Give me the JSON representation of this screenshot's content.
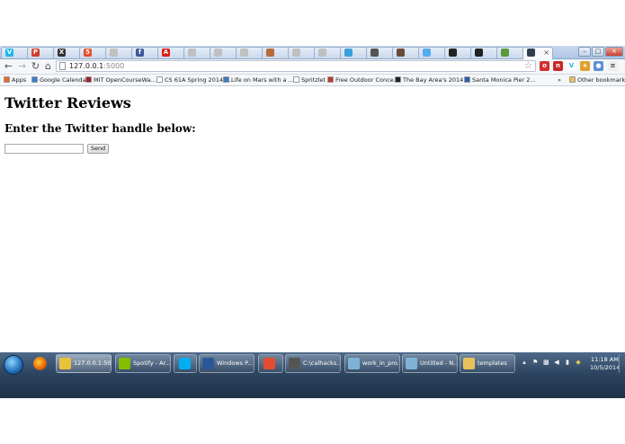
{
  "browser": {
    "tabs": [
      {
        "icon": "vimeo-icon",
        "color": "#1ab7ea",
        "glyph": "V"
      },
      {
        "icon": "pdf-icon",
        "color": "#d43b2f",
        "glyph": "P"
      },
      {
        "icon": "x-icon",
        "color": "#333333",
        "glyph": "X"
      },
      {
        "icon": "html5-icon",
        "color": "#e44d26",
        "glyph": "5"
      },
      {
        "icon": "page-icon",
        "color": "#c0c0c0",
        "glyph": ""
      },
      {
        "icon": "facebook-icon",
        "color": "#3b5998",
        "glyph": "f"
      },
      {
        "icon": "angular-icon",
        "color": "#dd1b16",
        "glyph": "A"
      },
      {
        "icon": "page-icon",
        "color": "#c0c0c0",
        "glyph": ""
      },
      {
        "icon": "page-icon",
        "color": "#c0c0c0",
        "glyph": ""
      },
      {
        "icon": "page-icon",
        "color": "#c0c0c0",
        "glyph": ""
      },
      {
        "icon": "image-icon",
        "color": "#b86b3a",
        "glyph": ""
      },
      {
        "icon": "page-icon",
        "color": "#c0c0c0",
        "glyph": ""
      },
      {
        "icon": "page-icon",
        "color": "#c0c0c0",
        "glyph": ""
      },
      {
        "icon": "tool-icon",
        "color": "#3aa0d8",
        "glyph": ""
      },
      {
        "icon": "box-icon",
        "color": "#555555",
        "glyph": ""
      },
      {
        "icon": "photo-icon",
        "color": "#6b4a3a",
        "glyph": ""
      },
      {
        "icon": "twitter-icon",
        "color": "#55acee",
        "glyph": ""
      },
      {
        "icon": "github-icon",
        "color": "#222222",
        "glyph": ""
      },
      {
        "icon": "github-icon",
        "color": "#222222",
        "glyph": ""
      },
      {
        "icon": "puzzle-icon",
        "color": "#5a9a3a",
        "glyph": ""
      },
      {
        "icon": "terminal-icon",
        "color": "#2d3e50",
        "glyph": "",
        "active": true
      }
    ],
    "address": {
      "host": "127.0.0.1",
      "port": ":5000"
    },
    "bookmarks": [
      {
        "label": "Apps",
        "color": "#e66b2a"
      },
      {
        "label": "Google Calendar",
        "color": "#3a7bd5"
      },
      {
        "label": "MIT OpenCourseWa...",
        "color": "#a31f34"
      },
      {
        "label": "CS 61A Spring 2014: ...",
        "color": "#ffffff"
      },
      {
        "label": "Life on Mars with a ...",
        "color": "#3b7bbf"
      },
      {
        "label": "Spritzlet",
        "color": "#ffffff"
      },
      {
        "label": "Free Outdoor Conce...",
        "color": "#c0392b"
      },
      {
        "label": "The Bay Area's 2014 ...",
        "color": "#222222"
      },
      {
        "label": "Santa Monica Pier 2...",
        "color": "#2a5db0"
      },
      {
        "label": "Other bookmarks",
        "color": "#e8c15a"
      }
    ],
    "bookmarks_overflow": "»"
  },
  "page": {
    "title": "Twitter Reviews",
    "subtitle": "Enter the Twitter handle below:",
    "input_value": "",
    "send_label": "Send"
  },
  "taskbar": {
    "items": [
      {
        "label": "127.0.0.1:50...",
        "icon": "chrome-icon",
        "color": "#e8c23a",
        "active": true
      },
      {
        "label": "Spotify - Ar...",
        "icon": "spotify-icon",
        "color": "#84bd00"
      },
      {
        "label": "",
        "icon": "skype-icon",
        "color": "#00aff0"
      },
      {
        "label": "Windows P...",
        "icon": "powershell-icon",
        "color": "#2b5797"
      },
      {
        "label": "",
        "icon": "git-icon",
        "color": "#e44c30"
      },
      {
        "label": "C:\\calhacks...",
        "icon": "sublime-icon",
        "color": "#555555"
      },
      {
        "label": "work_in_pro...",
        "icon": "notepad-icon",
        "color": "#7fb3d5"
      },
      {
        "label": "Untitled - N...",
        "icon": "notepad-icon",
        "color": "#7fb3d5"
      },
      {
        "label": "templates",
        "icon": "folder-icon",
        "color": "#e8c15a"
      }
    ],
    "clock": {
      "time": "11:18 AM",
      "date": "10/5/2014"
    }
  }
}
